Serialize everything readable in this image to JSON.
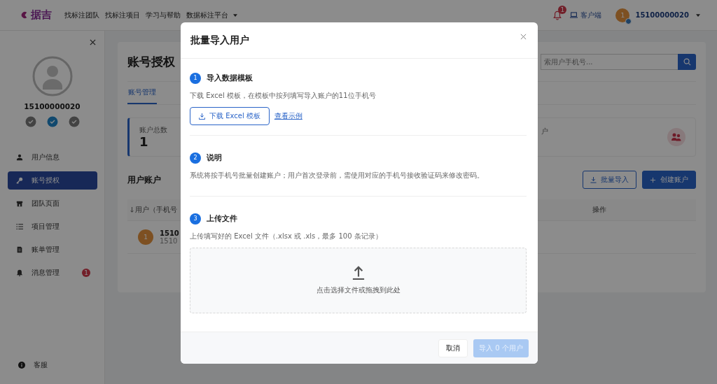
{
  "topbar": {
    "logo": "据吉",
    "nav": [
      "找标注团队",
      "找标注项目",
      "学习与帮助",
      "数据标注平台"
    ],
    "notification_badge": "1",
    "client_link": "客户端",
    "user": {
      "avatar": "1",
      "phone": "15100000020"
    }
  },
  "sidebar": {
    "phone": "15100000020",
    "status_icons": [
      {
        "on": false
      },
      {
        "on": true
      },
      {
        "on": false
      }
    ],
    "items": [
      {
        "label": "用户信息",
        "selected": false
      },
      {
        "label": "账号授权",
        "selected": true
      },
      {
        "label": "团队页面",
        "selected": false
      },
      {
        "label": "项目管理",
        "selected": false
      },
      {
        "label": "账单管理",
        "selected": false
      },
      {
        "label": "消息管理",
        "selected": false,
        "badge": "1"
      }
    ],
    "support": "客服"
  },
  "page": {
    "title": "账号授权",
    "search_placeholder": "索用户手机号...",
    "tabs": [
      {
        "label": "账号管理",
        "selected": true
      }
    ],
    "stats": [
      {
        "label": "账户总数",
        "value": "1"
      },
      {
        "label": "户"
      }
    ],
    "section_title": "用户账户",
    "buttons": [
      "批量导入",
      "创建账户"
    ],
    "table": {
      "columns": [
        "用户（手机号",
        "操作"
      ],
      "rows": [
        {
          "avatar": "1",
          "name": "1510",
          "sub": "1510"
        }
      ]
    }
  },
  "modal": {
    "title": "批量导入用户",
    "steps": [
      {
        "number": "1",
        "title": "导入数据模板",
        "description": "下载 Excel 模板，在模板中按列填写导入账户的11位手机号",
        "kind": "download",
        "button": "下载 Excel 模板",
        "link": "查看示例"
      },
      {
        "number": "2",
        "title": "说明",
        "description": "系统将按手机号批量创建账户；用户首次登录前，需使用对应的手机号接收验证码来修改密码。",
        "kind": "text"
      },
      {
        "number": "3",
        "title": "上传文件",
        "description": "上传填写好的 Excel 文件（.xlsx 或 .xls，最多 100 条记录）",
        "kind": "upload",
        "dropzone_text": "点击选择文件或拖拽到此处"
      }
    ],
    "cancel": "取消",
    "confirm": {
      "label": "导入 0 个用户",
      "disabled": true
    }
  }
}
